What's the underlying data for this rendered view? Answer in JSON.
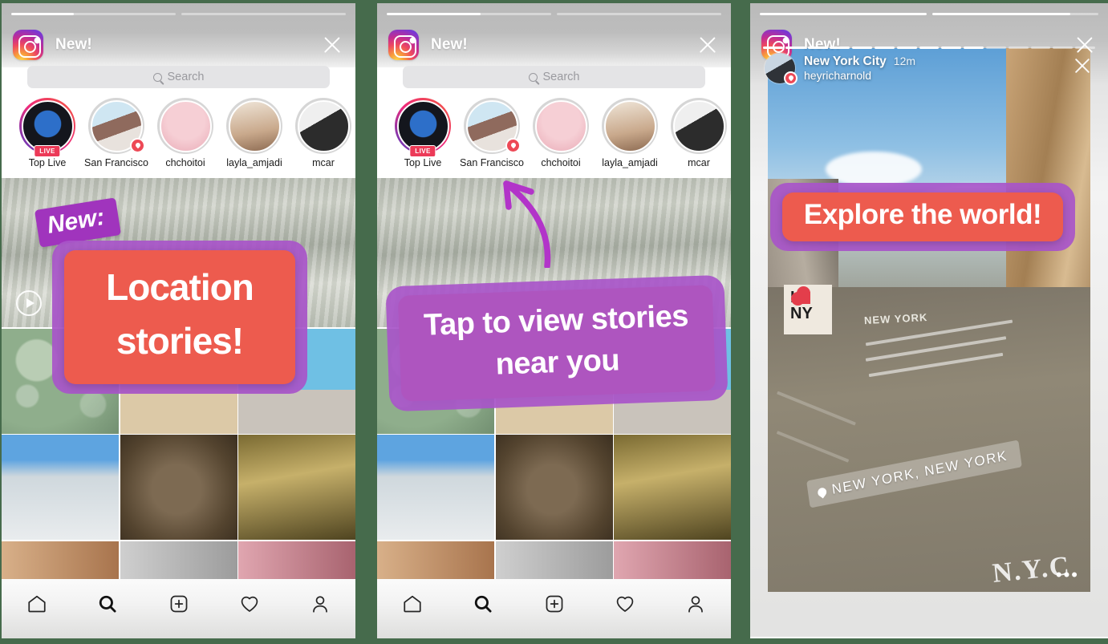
{
  "meta": {
    "background_color": "#466b4c",
    "accent_coral": "#ed5b4e",
    "accent_purple": "#a034bd"
  },
  "overlay_header": {
    "logo_name": "instagram-logo",
    "title": "New!",
    "close_label": "×"
  },
  "search": {
    "placeholder": "Search",
    "icon": "search-icon"
  },
  "story_tray": [
    {
      "label": "Top Live",
      "badge": "LIVE",
      "badge_type": "live",
      "art": "av-live",
      "ring": "live-ring"
    },
    {
      "label": "San Francisco",
      "badge": "",
      "badge_type": "location",
      "art": "av-sf",
      "ring": "seen"
    },
    {
      "label": "chchoitoi",
      "badge": "",
      "badge_type": "none",
      "art": "av-ch",
      "ring": "seen"
    },
    {
      "label": "layla_amjadi",
      "badge": "",
      "badge_type": "none",
      "art": "av-la",
      "ring": "seen"
    },
    {
      "label": "mcar",
      "badge": "",
      "badge_type": "none",
      "art": "av-mc",
      "ring": "seen"
    }
  ],
  "bottom_nav": [
    {
      "name": "home",
      "label": "Home"
    },
    {
      "name": "search",
      "label": "Search"
    },
    {
      "name": "add",
      "label": "Add post"
    },
    {
      "name": "activity",
      "label": "Activity"
    },
    {
      "name": "profile",
      "label": "Profile"
    }
  ],
  "panels": [
    {
      "id": "panel-1",
      "progress": [
        38,
        0
      ],
      "annotations": {
        "badge": "New:",
        "callout_line1": "Location",
        "callout_line2": "stories!"
      }
    },
    {
      "id": "panel-2",
      "progress": [
        57,
        0
      ],
      "annotations": {
        "callout_line1": "Tap to view stories",
        "callout_line2": "near you",
        "arrow": "curved-arrow-up"
      }
    },
    {
      "id": "panel-3",
      "progress": [
        100,
        83
      ],
      "story": {
        "location": "New York City",
        "time_ago": "12m",
        "username": "heyricharnold",
        "sign_line1": "I",
        "sign_line2": "NY",
        "building_label": "NEW YORK",
        "location_sticker": "NEW YORK, NEW YORK",
        "graffiti": "N.Y.C",
        "more_dots": "•••"
      },
      "annotations": {
        "callout_line1": "Explore the world!"
      }
    }
  ]
}
